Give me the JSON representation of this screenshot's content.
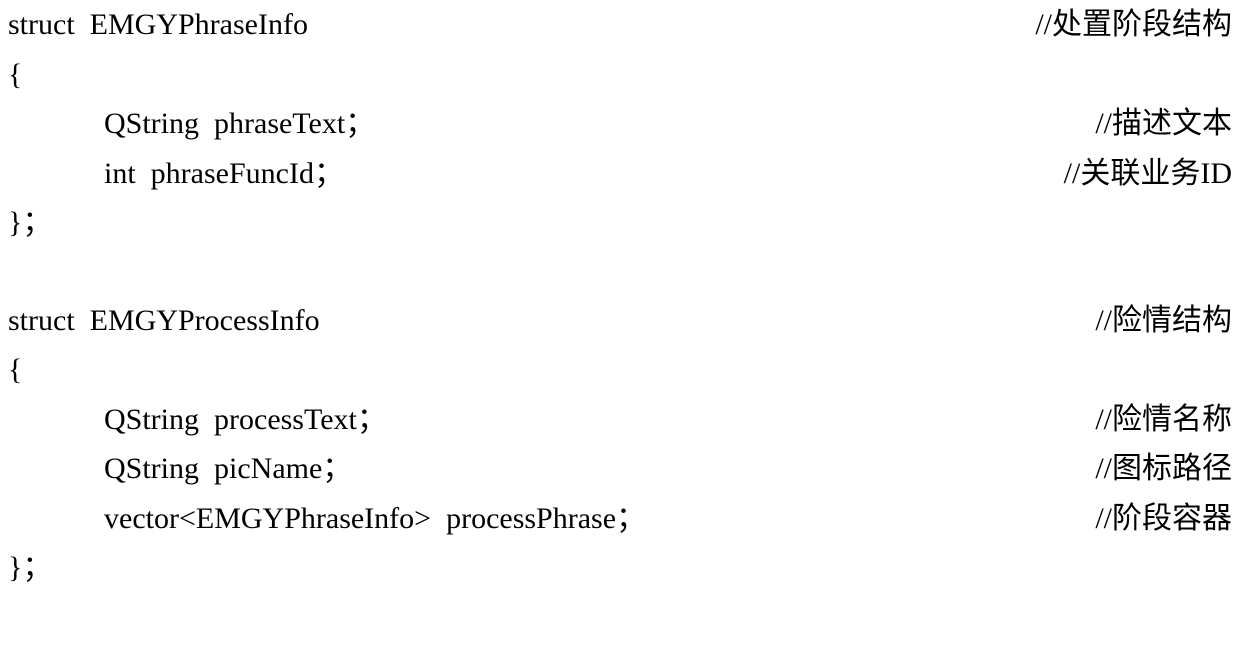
{
  "struct1": {
    "declaration": "struct  EMGYPhraseInfo",
    "declComment": "//处置阶段结构",
    "openBrace": "{",
    "field1": "QString  phraseText；",
    "field1Comment": "//描述文本",
    "field2": "int  phraseFuncId；",
    "field2Comment": "//关联业务ID",
    "closeBrace": "}；"
  },
  "struct2": {
    "declaration": "struct  EMGYProcessInfo",
    "declComment": "//险情结构",
    "openBrace": "{",
    "field1": "QString  processText；",
    "field1Comment": "//险情名称",
    "field2": "QString  picName；",
    "field2Comment": "//图标路径",
    "field3": "vector<EMGYPhraseInfo>  processPhrase；",
    "field3Comment": "//阶段容器",
    "closeBrace": "}；"
  }
}
